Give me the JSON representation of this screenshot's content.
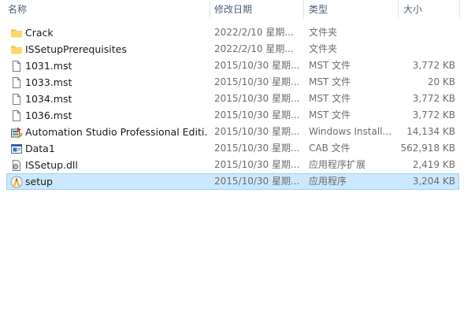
{
  "columns": {
    "name": "名称",
    "date": "修改日期",
    "type": "类型",
    "size": "大小"
  },
  "files": [
    {
      "name": "Crack",
      "date": "2022/2/10 星期...",
      "type": "文件夹",
      "size": "",
      "icon": "folder-icon"
    },
    {
      "name": "ISSetupPrerequisites",
      "date": "2022/2/10 星期...",
      "type": "文件夹",
      "size": "",
      "icon": "folder-icon"
    },
    {
      "name": "1031.mst",
      "date": "2015/10/30 星期...",
      "type": "MST 文件",
      "size": "3,772 KB",
      "icon": "file-icon"
    },
    {
      "name": "1033.mst",
      "date": "2015/10/30 星期...",
      "type": "MST 文件",
      "size": "20 KB",
      "icon": "file-icon"
    },
    {
      "name": "1034.mst",
      "date": "2015/10/30 星期...",
      "type": "MST 文件",
      "size": "3,772 KB",
      "icon": "file-icon"
    },
    {
      "name": "1036.mst",
      "date": "2015/10/30 星期...",
      "type": "MST 文件",
      "size": "3,772 KB",
      "icon": "file-icon"
    },
    {
      "name": "Automation Studio Professional Editi...",
      "date": "2015/10/30 星期...",
      "type": "Windows Install...",
      "size": "14,134 KB",
      "icon": "installer-package-icon"
    },
    {
      "name": "Data1",
      "date": "2015/10/30 星期...",
      "type": "CAB 文件",
      "size": "562,918 KB",
      "icon": "cab-archive-icon"
    },
    {
      "name": "ISSetup.dll",
      "date": "2015/10/30 星期...",
      "type": "应用程序扩展",
      "size": "2,419 KB",
      "icon": "dll-gear-icon"
    },
    {
      "name": "setup",
      "date": "2015/10/30 星期...",
      "type": "应用程序",
      "size": "3,204 KB",
      "icon": "setup-app-icon",
      "selected": true
    }
  ],
  "colors": {
    "selection_bg": "#cce8ff",
    "selection_border": "#99d1ff",
    "folder": "#ffd766",
    "header_text": "#4c607a",
    "secondary_text": "#6d6d6d"
  }
}
